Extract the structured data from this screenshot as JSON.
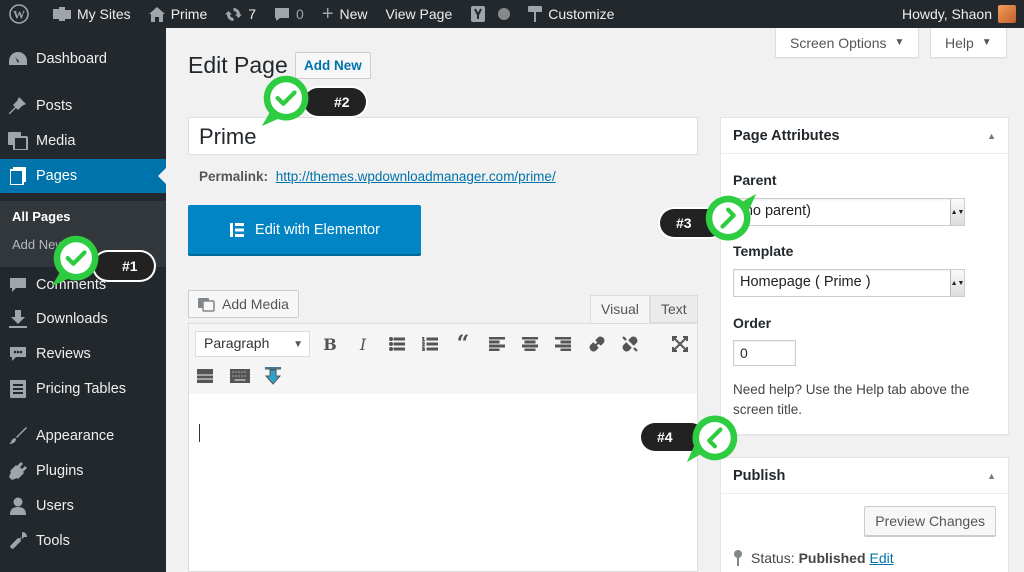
{
  "adminbar": {
    "my_sites": "My Sites",
    "site_name": "Prime",
    "updates_count": "7",
    "comments_count": "0",
    "new_label": "New",
    "view_page": "View Page",
    "customize": "Customize",
    "howdy": "Howdy, Shaon"
  },
  "sidebar": {
    "items": [
      {
        "label": "Dashboard",
        "icon": "dashboard-icon"
      },
      {
        "label": "Posts",
        "icon": "pin-icon"
      },
      {
        "label": "Media",
        "icon": "media-icon"
      },
      {
        "label": "Pages",
        "icon": "pages-icon"
      },
      {
        "label": "Comments",
        "icon": "comments-icon"
      },
      {
        "label": "Downloads",
        "icon": "download-icon"
      },
      {
        "label": "Reviews",
        "icon": "reviews-icon"
      },
      {
        "label": "Pricing Tables",
        "icon": "table-icon"
      },
      {
        "label": "Appearance",
        "icon": "brush-icon"
      },
      {
        "label": "Plugins",
        "icon": "plugin-icon"
      },
      {
        "label": "Users",
        "icon": "users-icon"
      },
      {
        "label": "Tools",
        "icon": "wrench-icon"
      }
    ],
    "submenu": {
      "all_pages": "All Pages",
      "add_new": "Add New"
    }
  },
  "screen_options": "Screen Options",
  "help": "Help",
  "page": {
    "heading": "Edit Page",
    "add_new": "Add New",
    "title_value": "Prime",
    "permalink_label": "Permalink:",
    "permalink_url": "http://themes.wpdownloadmanager.com/prime/",
    "elementor_button": "Edit with Elementor"
  },
  "editor": {
    "add_media": "Add Media",
    "tab_visual": "Visual",
    "tab_text": "Text",
    "format": "Paragraph",
    "buttons": [
      "bold",
      "italic",
      "bullet-list",
      "numbered-list",
      "blockquote",
      "align-left",
      "align-center",
      "align-right",
      "link",
      "unlink",
      "fullscreen",
      "read-more",
      "toolbar-toggle",
      "download-insert"
    ]
  },
  "page_attributes": {
    "title": "Page Attributes",
    "parent_label": "Parent",
    "parent_value": "(no parent)",
    "template_label": "Template",
    "template_value": "Homepage ( Prime )",
    "order_label": "Order",
    "order_value": "0",
    "help_text": "Need help? Use the Help tab above the screen title."
  },
  "publish": {
    "title": "Publish",
    "preview": "Preview Changes",
    "status_label": "Status:",
    "status_value": "Published",
    "edit": "Edit"
  },
  "callouts": [
    "#1",
    "#2",
    "#3",
    "#4"
  ],
  "colors": {
    "accent": "#0073aa",
    "check_green": "#2ecc40",
    "admin_dark": "#23282d"
  }
}
